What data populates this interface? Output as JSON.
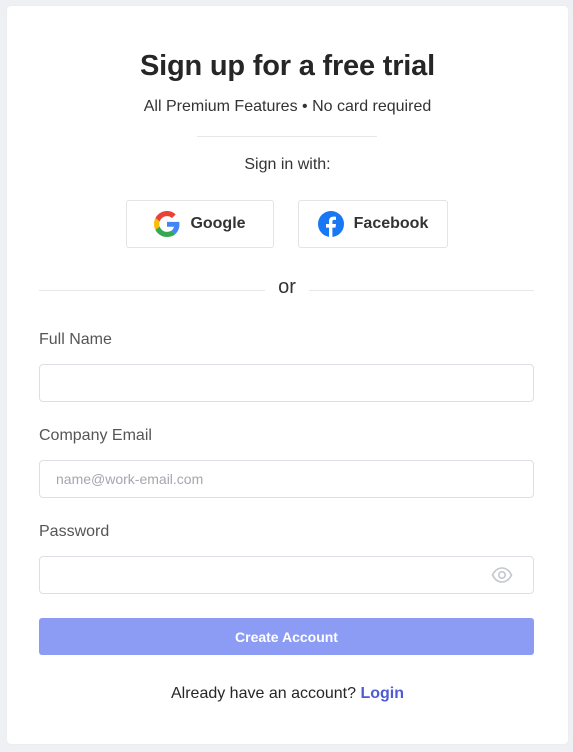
{
  "header": {
    "title": "Sign up for a free trial",
    "subtitle": "All Premium Features • No card required"
  },
  "social": {
    "prompt": "Sign in with:",
    "google_label": "Google",
    "facebook_label": "Facebook"
  },
  "divider": {
    "or_text": "or"
  },
  "form": {
    "full_name": {
      "label": "Full Name",
      "value": "",
      "placeholder": ""
    },
    "email": {
      "label": "Company Email",
      "value": "",
      "placeholder": "name@work-email.com"
    },
    "password": {
      "label": "Password",
      "value": "",
      "placeholder": ""
    },
    "submit_label": "Create Account"
  },
  "footer": {
    "prompt": "Already have an account?",
    "login_label": "Login"
  },
  "colors": {
    "accent": "#8c9cf5",
    "link": "#4f5bd5",
    "facebook_blue": "#1877f2"
  },
  "icons": {
    "google": "google-icon",
    "facebook": "facebook-icon",
    "eye": "eye-icon"
  }
}
